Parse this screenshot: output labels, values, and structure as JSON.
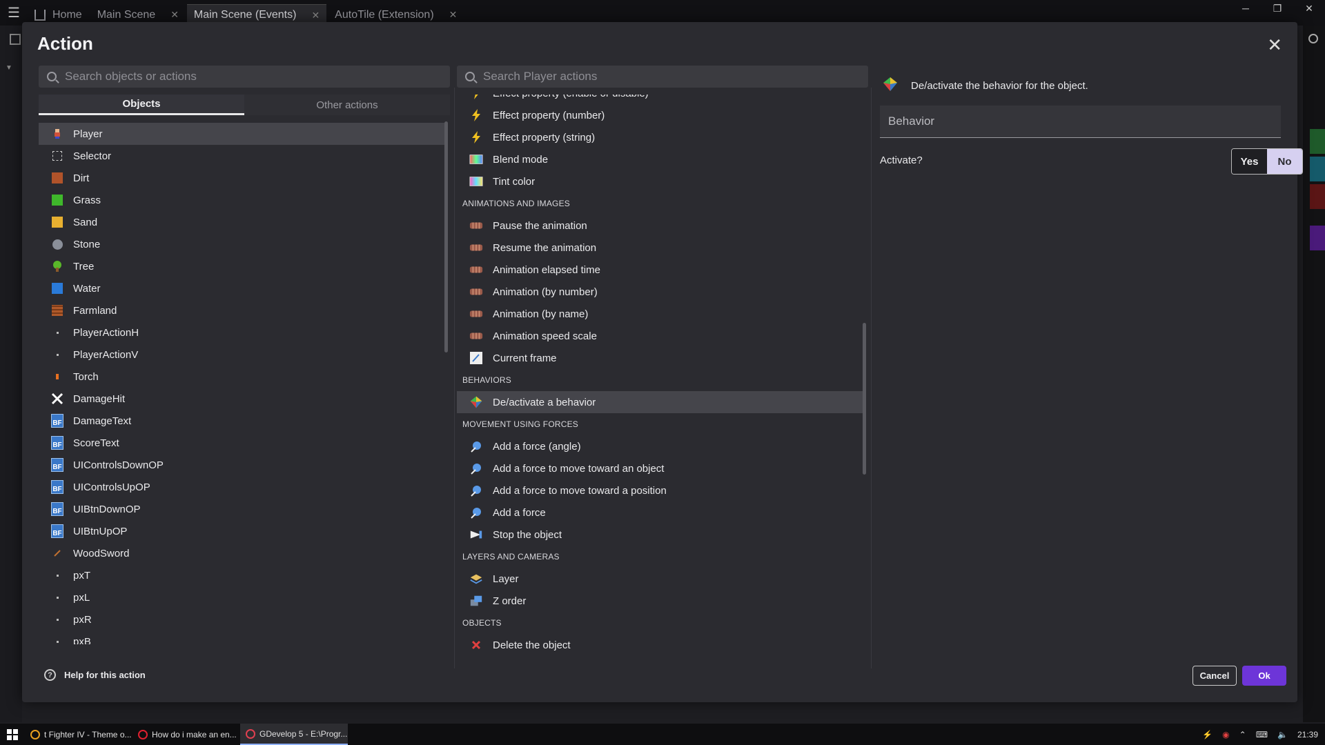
{
  "app_tabs": [
    {
      "label": "Home",
      "closable": false,
      "active": false
    },
    {
      "label": "Main Scene",
      "closable": true,
      "active": false
    },
    {
      "label": "Main Scene (Events)",
      "closable": true,
      "active": true
    },
    {
      "label": "AutoTile (Extension)",
      "closable": true,
      "active": false
    }
  ],
  "dialog": {
    "title": "Action",
    "objects_search_placeholder": "Search objects or actions",
    "actions_search_placeholder": "Search Player actions",
    "tabs": [
      "Objects",
      "Other actions"
    ],
    "help_label": "Help for this action",
    "cancel_label": "Cancel",
    "ok_label": "Ok"
  },
  "objects": [
    {
      "name": "Player",
      "icon": "player-sprite-icon",
      "color": "#d0503a",
      "selected": true
    },
    {
      "name": "Selector",
      "icon": "selector-icon",
      "color": "#cccccc"
    },
    {
      "name": "Dirt",
      "icon": "tile-icon",
      "color": "#b0532a"
    },
    {
      "name": "Grass",
      "icon": "tile-icon",
      "color": "#3fb82b"
    },
    {
      "name": "Sand",
      "icon": "tile-icon",
      "color": "#e8b030"
    },
    {
      "name": "Stone",
      "icon": "stone-icon",
      "color": "#8a8f99"
    },
    {
      "name": "Tree",
      "icon": "tree-icon",
      "color": "#5ab82a"
    },
    {
      "name": "Water",
      "icon": "tile-icon",
      "color": "#2a7ad8"
    },
    {
      "name": "Farmland",
      "icon": "farmland-icon",
      "color": "#b05a2a"
    },
    {
      "name": "PlayerActionH",
      "icon": "dot-icon",
      "color": "#bbbbbb"
    },
    {
      "name": "PlayerActionV",
      "icon": "dot-icon",
      "color": "#bbbbbb"
    },
    {
      "name": "Torch",
      "icon": "torch-icon",
      "color": "#e87020"
    },
    {
      "name": "DamageHit",
      "icon": "damage-hit-icon",
      "color": "#ffffff"
    },
    {
      "name": "DamageText",
      "icon": "bitmap-text-icon",
      "color": "#3a78c8"
    },
    {
      "name": "ScoreText",
      "icon": "bitmap-text-icon",
      "color": "#3a78c8"
    },
    {
      "name": "UIControlsDownOP",
      "icon": "bitmap-text-icon",
      "color": "#3a78c8"
    },
    {
      "name": "UIControlsUpOP",
      "icon": "bitmap-text-icon",
      "color": "#3a78c8"
    },
    {
      "name": "UIBtnDownOP",
      "icon": "bitmap-text-icon",
      "color": "#3a78c8"
    },
    {
      "name": "UIBtnUpOP",
      "icon": "bitmap-text-icon",
      "color": "#3a78c8"
    },
    {
      "name": "WoodSword",
      "icon": "sword-icon",
      "color": "#c07030"
    },
    {
      "name": "pxT",
      "icon": "dot-icon",
      "color": "#888888"
    },
    {
      "name": "pxL",
      "icon": "dot-icon",
      "color": "#888888"
    },
    {
      "name": "pxR",
      "icon": "dot-icon",
      "color": "#888888"
    },
    {
      "name": "pxB",
      "icon": "dot-icon",
      "color": "#888888"
    }
  ],
  "actions": [
    {
      "type": "item",
      "label": "Effect property (enable or disable)",
      "icon": "effect-icon"
    },
    {
      "type": "item",
      "label": "Effect property (number)",
      "icon": "effect-icon"
    },
    {
      "type": "item",
      "label": "Effect property (string)",
      "icon": "effect-icon"
    },
    {
      "type": "item",
      "label": "Blend mode",
      "icon": "blend-icon"
    },
    {
      "type": "item",
      "label": "Tint color",
      "icon": "tint-icon"
    },
    {
      "type": "category",
      "label": "ANIMATIONS AND IMAGES"
    },
    {
      "type": "item",
      "label": "Pause the animation",
      "icon": "animation-icon"
    },
    {
      "type": "item",
      "label": "Resume the animation",
      "icon": "animation-icon"
    },
    {
      "type": "item",
      "label": "Animation elapsed time",
      "icon": "animation-icon"
    },
    {
      "type": "item",
      "label": "Animation (by number)",
      "icon": "animation-icon"
    },
    {
      "type": "item",
      "label": "Animation (by name)",
      "icon": "animation-icon"
    },
    {
      "type": "item",
      "label": "Animation speed scale",
      "icon": "animation-icon"
    },
    {
      "type": "item",
      "label": "Current frame",
      "icon": "frame-icon"
    },
    {
      "type": "category",
      "label": "BEHAVIORS"
    },
    {
      "type": "item",
      "label": "De/activate a behavior",
      "icon": "behavior-icon",
      "selected": true
    },
    {
      "type": "category",
      "label": "MOVEMENT USING FORCES"
    },
    {
      "type": "item",
      "label": "Add a force (angle)",
      "icon": "force-icon"
    },
    {
      "type": "item",
      "label": "Add a force to move toward an object",
      "icon": "force-icon"
    },
    {
      "type": "item",
      "label": "Add a force to move toward a position",
      "icon": "force-icon"
    },
    {
      "type": "item",
      "label": "Add a force",
      "icon": "force-icon"
    },
    {
      "type": "item",
      "label": "Stop the object",
      "icon": "stop-icon"
    },
    {
      "type": "category",
      "label": "LAYERS AND CAMERAS"
    },
    {
      "type": "item",
      "label": "Layer",
      "icon": "layer-icon"
    },
    {
      "type": "item",
      "label": "Z order",
      "icon": "z-order-icon"
    },
    {
      "type": "category",
      "label": "OBJECTS"
    },
    {
      "type": "item",
      "label": "Delete the object",
      "icon": "delete-icon"
    }
  ],
  "details": {
    "description": "De/activate the behavior for the object.",
    "behavior_label": "Behavior",
    "activate_label": "Activate?",
    "yes_label": "Yes",
    "no_label": "No",
    "selected": "No"
  },
  "taskbar": {
    "items": [
      {
        "label": "t Fighter IV - Theme o...",
        "icon": "media-player-icon",
        "active": false
      },
      {
        "label": "How do i make an en...",
        "icon": "opera-icon",
        "active": false
      },
      {
        "label": "GDevelop 5 - E:\\Progr...",
        "icon": "gdevelop-icon",
        "active": true
      }
    ],
    "time": "21:39"
  }
}
